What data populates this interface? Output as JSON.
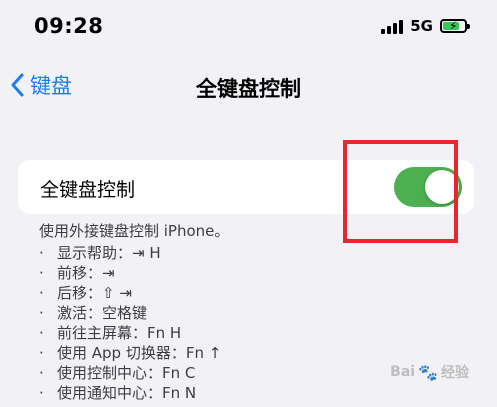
{
  "status": {
    "time": "09:28",
    "network": "5G"
  },
  "nav": {
    "back_label": "键盘",
    "title": "全键盘控制"
  },
  "setting": {
    "label": "全键盘控制",
    "enabled": true
  },
  "description": {
    "intro": "使用外接键盘控制 iPhone。",
    "items": [
      "显示帮助：⇥ H",
      "前移：⇥",
      "后移：⇧ ⇥",
      "激活：空格键",
      "前往主屏幕：Fn H",
      "使用 App 切换器：Fn ↑",
      "使用控制中心：Fn C",
      "使用通知中心：Fn N"
    ]
  },
  "watermark": {
    "brand": "Bai",
    "paw": "🐾",
    "suffix": "经验"
  },
  "colors": {
    "accent": "#1e7cf2",
    "toggle_on": "#4caf50",
    "highlight": "#e8262d"
  }
}
